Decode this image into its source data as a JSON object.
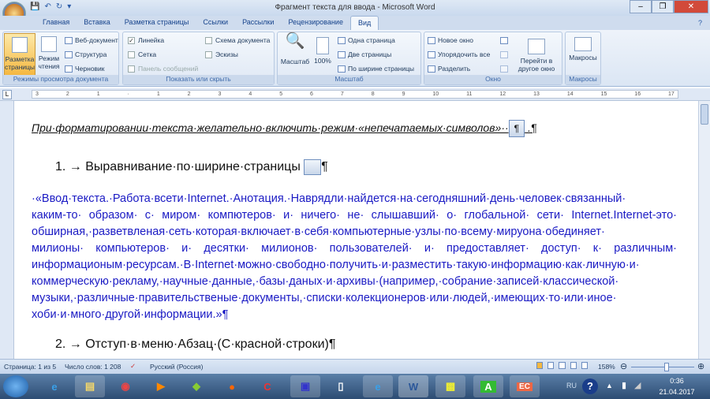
{
  "window": {
    "title": "Фрагмент текста для ввода - Microsoft Word"
  },
  "tabs": [
    "Главная",
    "Вставка",
    "Разметка страницы",
    "Ссылки",
    "Рассылки",
    "Рецензирование",
    "Вид"
  ],
  "ribbon": {
    "views": {
      "label": "Режимы просмотра документа",
      "print_layout": "Разметка страницы",
      "reading": "Режим чтения",
      "web": "Веб-документ",
      "outline": "Структура",
      "draft": "Черновик"
    },
    "show": {
      "label": "Показать или скрыть",
      "ruler": "Линейка",
      "grid": "Сетка",
      "message_bar": "Панель сообщений",
      "doc_map": "Схема документа",
      "thumbnails": "Эскизы",
      "ruler_checked": true
    },
    "zoom": {
      "label": "Масштаб",
      "zoom": "Масштаб",
      "hundred": "100%",
      "one_page": "Одна страница",
      "two_pages": "Две страницы",
      "page_width": "По ширине страницы"
    },
    "window": {
      "label": "Окно",
      "new": "Новое окно",
      "arrange": "Упорядочить все",
      "split": "Разделить",
      "switch": "Перейти в другое окно"
    },
    "macros": {
      "label": "Макросы",
      "macros": "Макросы"
    }
  },
  "ruler_ticks": [
    "3",
    "2",
    "1",
    "·",
    "1",
    "2",
    "3",
    "4",
    "5",
    "6",
    "7",
    "8",
    "9",
    "10",
    "11",
    "12",
    "13",
    "14",
    "15",
    "16",
    "17"
  ],
  "document": {
    "heading": "При·форматировании·текста·желательно·включить·режим·«непечатаемых·символов»··",
    "pilcrow_icon": "¶",
    "heading_end": " .¶",
    "item1": "1. → Выравнивание·по·ширине·страницы",
    "item1_end": "¶",
    "paragraph_lines": [
      "·«Ввод·текста.·Работа·всети·Internet.·Анотация.·Наврядли·найдется·на·сегодняшний·день·человек·связанный·",
      "каким-то· образом· с· миром· компютеров· и· ничего· не· слышавший· о· глобальной· сети· Internet.Internet-это·",
      "обширная,·разветвленая·сеть·которая·включает·в·себя·компьютерные·узлы·по·всему·мируона·обединяет·",
      "милионы· компьютеров· и· десятки· милионов· пользователей· и· предоставляет· доступ· к· различным·",
      "информационым·ресурсам.·В·Internet·можно·свободно·получить·и·разместить·такую·информацию·как·личную·и·",
      "коммерческую·рекламу,·научные·данные,·базы·даных·и·архивы·(например,·собрание·записей·классической·",
      "музыки,·различные·правительственые·документы,·списки·колекционеров·или·людей,·имеющих·то·или·иное·",
      "хоби·и·много·другой·информации.»¶"
    ],
    "item2": "2. → Отступ·в·меню·Абзац·(С·красной·строки)¶"
  },
  "status": {
    "page": "Страница: 1 из 5",
    "words": "Число слов: 1 208",
    "language": "Русский (Россия)",
    "zoom": "158%"
  },
  "taskbar": {
    "lang": "RU",
    "time": "0:36",
    "date": "21.04.2017"
  },
  "colors": {
    "text_blue": "#1a1ac4",
    "accent": "#f5b841"
  }
}
